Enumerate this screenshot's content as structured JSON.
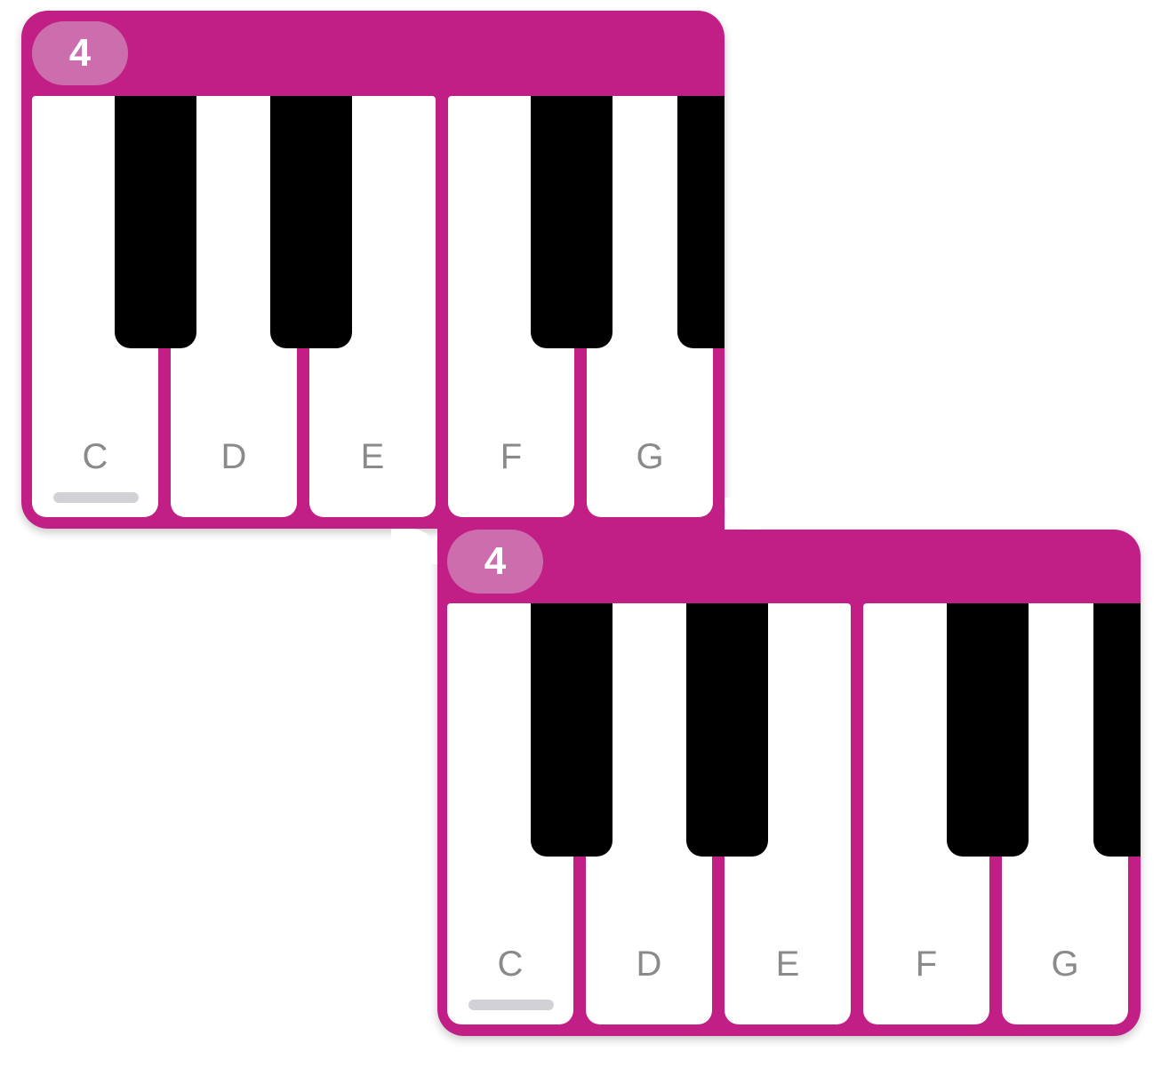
{
  "keyboards": [
    {
      "octave_label": "4",
      "white_keys": [
        {
          "note": "C",
          "active_indicator": true
        },
        {
          "note": "D",
          "active_indicator": false
        },
        {
          "note": "E",
          "active_indicator": false
        },
        {
          "note": "F",
          "active_indicator": false
        },
        {
          "note": "G",
          "active_indicator": false
        }
      ]
    },
    {
      "octave_label": "4",
      "white_keys": [
        {
          "note": "C",
          "active_indicator": true
        },
        {
          "note": "D",
          "active_indicator": false
        },
        {
          "note": "E",
          "active_indicator": false
        },
        {
          "note": "F",
          "active_indicator": false
        },
        {
          "note": "G",
          "active_indicator": false
        }
      ]
    }
  ],
  "colors": {
    "frame": "#c21f86",
    "badge": "#cc6ead",
    "white_key": "#ffffff",
    "black_key": "#000000",
    "note_label": "#8a8a8a",
    "indicator": "#d2d2d6"
  }
}
